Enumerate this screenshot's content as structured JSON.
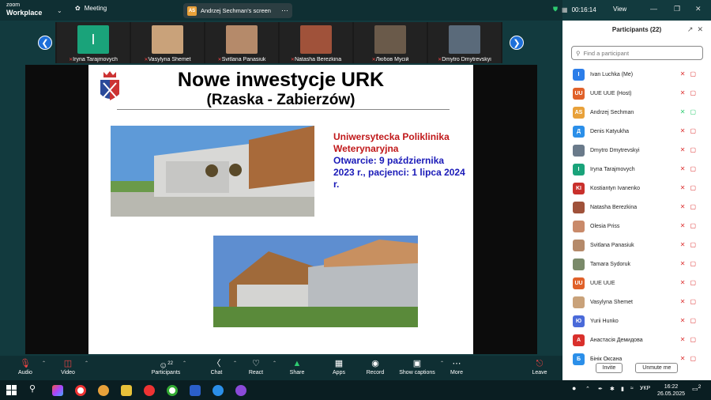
{
  "app": {
    "brand_line1": "zoom",
    "brand_line2": "Workplace",
    "meeting_label": "Meeting",
    "share_initials": "AS",
    "share_label": "Andrzej Sechman's screen",
    "timer": "00:16:14",
    "view_label": "View"
  },
  "strip": {
    "tiles": [
      {
        "name": "Iryna Tarajmovych",
        "initial": "I",
        "color": "#1aa37a"
      },
      {
        "name": "Vasylyna Shemet",
        "color": "#c9a27a"
      },
      {
        "name": "Svitlana Panasiuk",
        "color": "#b58a6a"
      },
      {
        "name": "Natasha Berezkina",
        "color": "#a0523a"
      },
      {
        "name": "Любов Мусій",
        "color": "#6a5a4a"
      },
      {
        "name": "Dmytro Dmytrevskyi",
        "color": "#5a6a7a"
      }
    ]
  },
  "slide": {
    "title": "Nowe inwestycje URK",
    "subtitle": "(Rzaska - Zabierzów)",
    "red_text": "Uniwersytecka Poliklinika Weterynaryjna",
    "blue_text": "Otwarcie: 9 października 2023 r., pacjenci: 1 lipca 2024 r."
  },
  "panel": {
    "title": "Participants (22)",
    "search_placeholder": "Find a participant",
    "invite": "Invite",
    "unmute_me": "Unmute me",
    "participants": [
      {
        "name": "Ivan Luchka (Me)",
        "initial": "I",
        "color": "#2b7de9"
      },
      {
        "name": "UUE UUE (Host)",
        "initial": "UU",
        "color": "#e0612a"
      },
      {
        "name": "Andrzej Sechman",
        "initial": "AS",
        "color": "#e8a13a"
      },
      {
        "name": "Denis Katyukha",
        "initial": "Д",
        "color": "#2b8fe9"
      },
      {
        "name": "Dmytro Dmytrevskyi",
        "initial": "",
        "color": "#6a7a8a"
      },
      {
        "name": "Iryna Tarajmovych",
        "initial": "I",
        "color": "#1aa37a"
      },
      {
        "name": "Kostiantyn Ivanenko",
        "initial": "KI",
        "color": "#c9302c"
      },
      {
        "name": "Natasha Berezkina",
        "initial": "",
        "color": "#a0523a"
      },
      {
        "name": "Olesia Priss",
        "initial": "",
        "color": "#c98a6a"
      },
      {
        "name": "Svitlana Panasiuk",
        "initial": "",
        "color": "#b58a6a"
      },
      {
        "name": "Tamara Sydoruk",
        "initial": "",
        "color": "#7a8a6a"
      },
      {
        "name": "UUE UUE",
        "initial": "UU",
        "color": "#e0612a"
      },
      {
        "name": "Vasylyna Shemet",
        "initial": "",
        "color": "#c9a27a"
      },
      {
        "name": "Yurii Hunko",
        "initial": "Ю",
        "color": "#4a6ad9"
      },
      {
        "name": "Анастасія Демидова",
        "initial": "А",
        "color": "#d9302c"
      },
      {
        "name": "Бінік Оксана",
        "initial": "Б",
        "color": "#2b8fe9"
      }
    ]
  },
  "toolbar": {
    "audio": "Audio",
    "video": "Video",
    "participants": "Participants",
    "participants_count": "22",
    "chat": "Chat",
    "react": "React",
    "share": "Share",
    "apps": "Apps",
    "record": "Record",
    "captions": "Show captions",
    "more": "More",
    "leave": "Leave"
  },
  "taskbar": {
    "lang": "УКР",
    "time": "16:22",
    "date": "26.05.2025",
    "notif": "2"
  }
}
